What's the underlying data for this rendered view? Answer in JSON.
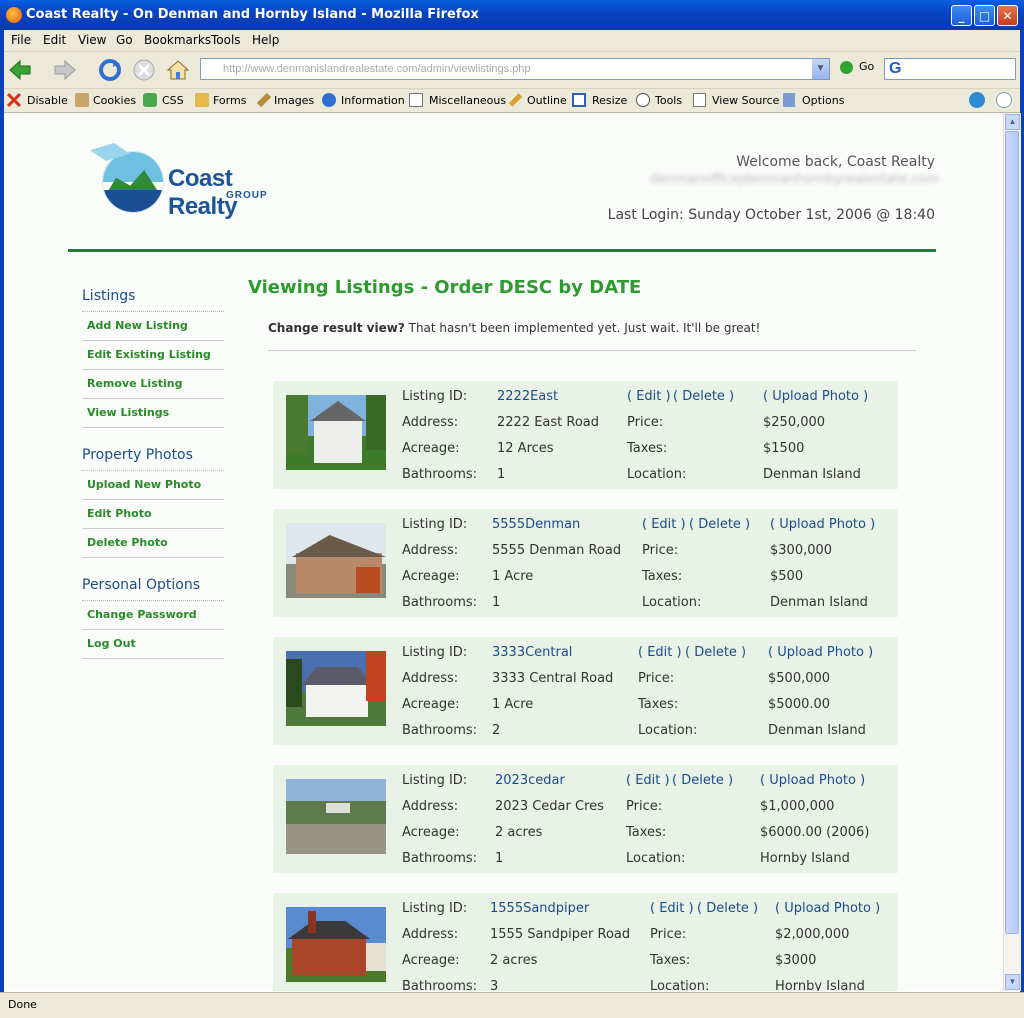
{
  "window": {
    "title": "Coast Realty - On Denman and Hornby Island - Mozilla Firefox",
    "controls": [
      "_",
      "□",
      "✕"
    ]
  },
  "menu": [
    "File",
    "Edit",
    "View",
    "Go",
    "Bookmarks",
    "Tools",
    "Help"
  ],
  "nav": {
    "url": "http://www.denmanislandrealestate.com/admin/viewlistings.php",
    "go_label": "Go",
    "search_glyph": "G"
  },
  "devtoolbar": [
    "Disable",
    "Cookies",
    "CSS",
    "Forms",
    "Images",
    "Information",
    "Miscellaneous",
    "Outline",
    "Resize",
    "Tools",
    "View Source",
    "Options"
  ],
  "status": "Done",
  "header": {
    "logo_name": "Coast Realty",
    "logo_group": "GROUP",
    "welcome": "Welcome back, Coast Realty",
    "email": "denmanofficejdenmanhornbyrealestate.com",
    "last_login": "Last Login: Sunday October 1st, 2006 @ 18:40"
  },
  "sidebar": {
    "sections": [
      {
        "title": "Listings",
        "items": [
          "Add New Listing",
          "Edit Existing Listing",
          "Remove Listing",
          "View Listings"
        ]
      },
      {
        "title": "Property Photos",
        "items": [
          "Upload New Photo",
          "Edit Photo",
          "Delete Photo"
        ]
      },
      {
        "title": "Personal Options",
        "items": [
          "Change Password",
          "Log Out"
        ]
      }
    ]
  },
  "main": {
    "title": "Viewing Listings - Order DESC by DATE",
    "change_view_label": "Change result view?",
    "change_view_text": " That hasn't been implemented yet. Just wait. It'll be great!"
  },
  "labels": {
    "listing_id": "Listing ID:",
    "address": "Address:",
    "acreage": "Acreage:",
    "bathrooms": "Bathrooms:",
    "price": "Price:",
    "taxes": "Taxes:",
    "location": "Location:",
    "edit": "( Edit )",
    "delete": "( Delete )",
    "upload": "( Upload Photo )"
  },
  "listings": [
    {
      "id": "2222East",
      "address": "2222 East Road",
      "acreage": "12 Arces",
      "bathrooms": "1",
      "price": "$250,000",
      "taxes": "$1500",
      "location": "Denman Island"
    },
    {
      "id": "5555Denman",
      "address": "5555 Denman Road",
      "acreage": "1 Acre",
      "bathrooms": "1",
      "price": "$300,000",
      "taxes": "$500",
      "location": "Denman Island"
    },
    {
      "id": "3333Central",
      "address": "3333 Central Road",
      "acreage": "1 Acre",
      "bathrooms": "2",
      "price": "$500,000",
      "taxes": "$5000.00",
      "location": "Denman Island"
    },
    {
      "id": "2023cedar",
      "address": "2023 Cedar Cres",
      "acreage": "2 acres",
      "bathrooms": "1",
      "price": "$1,000,000",
      "taxes": "$6000.00 (2006)",
      "location": "Hornby Island"
    },
    {
      "id": "1555Sandpiper",
      "address": "1555 Sandpiper Road",
      "acreage": "2 acres",
      "bathrooms": "3",
      "price": "$2,000,000",
      "taxes": "$3000",
      "location": "Hornby Island"
    }
  ]
}
